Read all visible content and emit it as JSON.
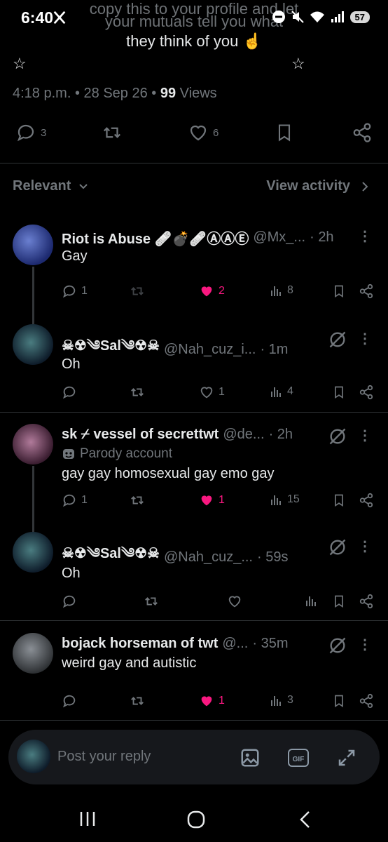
{
  "status_bar": {
    "time": "6:40",
    "battery": "57",
    "x_logo": "x-logo-icon"
  },
  "post": {
    "ghost_line1": "copy this to your profile and let",
    "ghost_line2": "your mutuals tell you what",
    "text_line": "they think of you",
    "text_emoji": "☝",
    "stars_left": "☆",
    "stars_right": "☆",
    "time": "4:18 p.m.",
    "date": "28 Sep 26",
    "views_count": "99",
    "views_label": "Views",
    "replies": "3",
    "likes": "6"
  },
  "sort": {
    "label": "Relevant",
    "activity": "View activity"
  },
  "replies": [
    {
      "name": "Riot is Abuse 🩹💣🩹ⒶⒶⒺ",
      "handle": "@Mx_...",
      "time": "2h",
      "text": "Gay",
      "replies": "1",
      "likes": "2",
      "views": "8",
      "liked": true
    },
    {
      "name": "☠☢︎༄Sal༄☢︎☠",
      "handle": "@Nah_cuz_i...",
      "time": "1m",
      "text": "Oh",
      "replies": "",
      "likes": "1",
      "views": "4",
      "liked": false
    },
    {
      "name": "sk ⌿ vessel of secrettwt",
      "handle": "@de...",
      "time": "2h",
      "parody": "Parody account",
      "text": "gay gay homosexual gay emo gay",
      "replies": "1",
      "likes": "1",
      "views": "15",
      "liked": true
    },
    {
      "name": "☠☢︎༄Sal༄☢︎☠",
      "handle": "@Nah_cuz_...",
      "time": "59s",
      "text": "Oh",
      "replies": "",
      "likes": "",
      "views": "",
      "liked": false
    },
    {
      "name": "bojack horseman of twt",
      "handle": "@...",
      "time": "35m",
      "text": "weird gay and autistic",
      "replies": "",
      "likes": "1",
      "views": "3",
      "liked": true
    }
  ],
  "reply_box": {
    "placeholder": "Post your reply"
  },
  "colors": {
    "accent_like": "#f91880",
    "muted": "#71767b",
    "text": "#e7e9ea"
  }
}
